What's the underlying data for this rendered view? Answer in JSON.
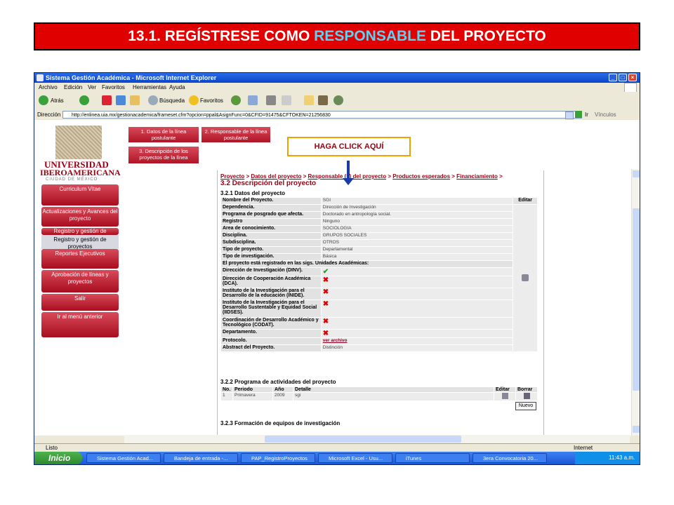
{
  "slide": {
    "title_pre": "13.1. REGÍSTRESE COMO ",
    "title_highlight": "RESPONSABLE",
    "title_post": " DEL PROYECTO",
    "callout": "HAGA CLICK AQUÍ"
  },
  "window": {
    "title": "Sistema Gestión Académica - Microsoft Internet Explorer",
    "menu": [
      "Archivo",
      "Edición",
      "Ver",
      "Favoritos",
      "Herramientas",
      "Ayuda"
    ],
    "toolbar": {
      "back": "Atrás",
      "search": "Búsqueda",
      "favorites": "Favoritos"
    },
    "address_label": "Dirección",
    "address_url": "http://enlinea.uia.mx/gestionacademica/frameset.cfm?opcion=ppal&AsignFunc=0&CFID=91475&CFTOKEN=21256830",
    "go_label": "Ir",
    "links_label": "Vínculos",
    "status_text": "Listo",
    "zone_text": "Internet"
  },
  "sidebar": {
    "logo_line1": "UNIVERSIDAD",
    "logo_line2": "IBEROAMERICANA",
    "logo_line3": "CIUDAD DE MÉXICO",
    "items": [
      "Curriculum Vitae",
      "Actualizaciones y Avances del proyecto",
      "Registro y gestión de",
      "Registro y gestión de proyectos",
      "Reportes Ejecutivos",
      "Aprobación de líneas y proyectos",
      "Salir",
      "Ir al menú anterior"
    ]
  },
  "tabs": [
    "1. Datos de la línea postulante",
    "2. Responsable de la línea postulante",
    "3. Descripción de los proyectos de la línea"
  ],
  "doc": {
    "breadcrumb": [
      "Proyecto",
      "Datos del proyecto",
      "Responsable (s) del proyecto",
      "Productos esperados",
      "Financiamiento"
    ],
    "section_title": "3.2 Descripción del proyecto",
    "sub1": "3.2.1 Datos del proyecto",
    "edit_header": "Editar",
    "rows": [
      {
        "label": "Nombre del Proyecto.",
        "value": "SGI"
      },
      {
        "label": "Dependencia.",
        "value": "Dirección de Investigación"
      },
      {
        "label": "Programa de posgrado que afecta.",
        "value": "Doctorado en antropología social."
      },
      {
        "label": "Registro",
        "value": "Ninguno"
      },
      {
        "label": "Area de conocimiento.",
        "value": "SOCIOLOGIA"
      },
      {
        "label": "Disciplina.",
        "value": "GRUPOS SOCIALES"
      },
      {
        "label": "Subdisciplina.",
        "value": "OTROS"
      },
      {
        "label": "Tipo de proyecto.",
        "value": "Departamental"
      },
      {
        "label": "Tipo de investigación.",
        "value": "Básica"
      }
    ],
    "units_header": "El proyecto está registrado en las sigs. Unidades Académicas:",
    "units": [
      {
        "label": "Dirección de Investigación (DINV).",
        "mark": "✔",
        "ok": true
      },
      {
        "label": "Dirección de Cooperación Académica (DCA).",
        "mark": "✖",
        "ok": false
      },
      {
        "label": "Instituto de la Investigación para el Desarrollo de la educación (INIDE).",
        "mark": "✖",
        "ok": false
      },
      {
        "label": "Instituto de la Investigación para el Desarrollo Sustentable y Equidad Social (IIDSES).",
        "mark": "✖",
        "ok": false
      },
      {
        "label": "Coordinación de Desarrollo Académico y Tecnológico (CODAT).",
        "mark": "✖",
        "ok": false
      },
      {
        "label": "Departamento.",
        "mark": "✖",
        "ok": false
      }
    ],
    "protocol_label": "Protocolo.",
    "protocol_link": "ver archivo",
    "abstract_label": "Abstract del Proyecto.",
    "abstract_value": "Distinción",
    "sub2": "3.2.2 Programa de actividades del proyecto",
    "act_headers": [
      "No.",
      "Periodo",
      "Año",
      "Detalle",
      "Editar",
      "Borrar"
    ],
    "act_row": [
      "1",
      "Primavera",
      "2009",
      "sgi"
    ],
    "new_button": "Nuevo",
    "sub3": "3.2.3 Formación de equipos de investigación"
  },
  "taskbar": {
    "start": "Inicio",
    "tasks": [
      "Sistema Gestión Acad...",
      "Bandeja de entrada -...",
      "PAP_RegistroProyectos",
      "Microsoft Excel - Usu...",
      "iTunes",
      "3era Convocatoria 20..."
    ],
    "clock": "11:43 a.m."
  },
  "colors": {
    "brand_red": "#a00014",
    "banner_red": "#e00000",
    "highlight": "#5fd0f0"
  }
}
